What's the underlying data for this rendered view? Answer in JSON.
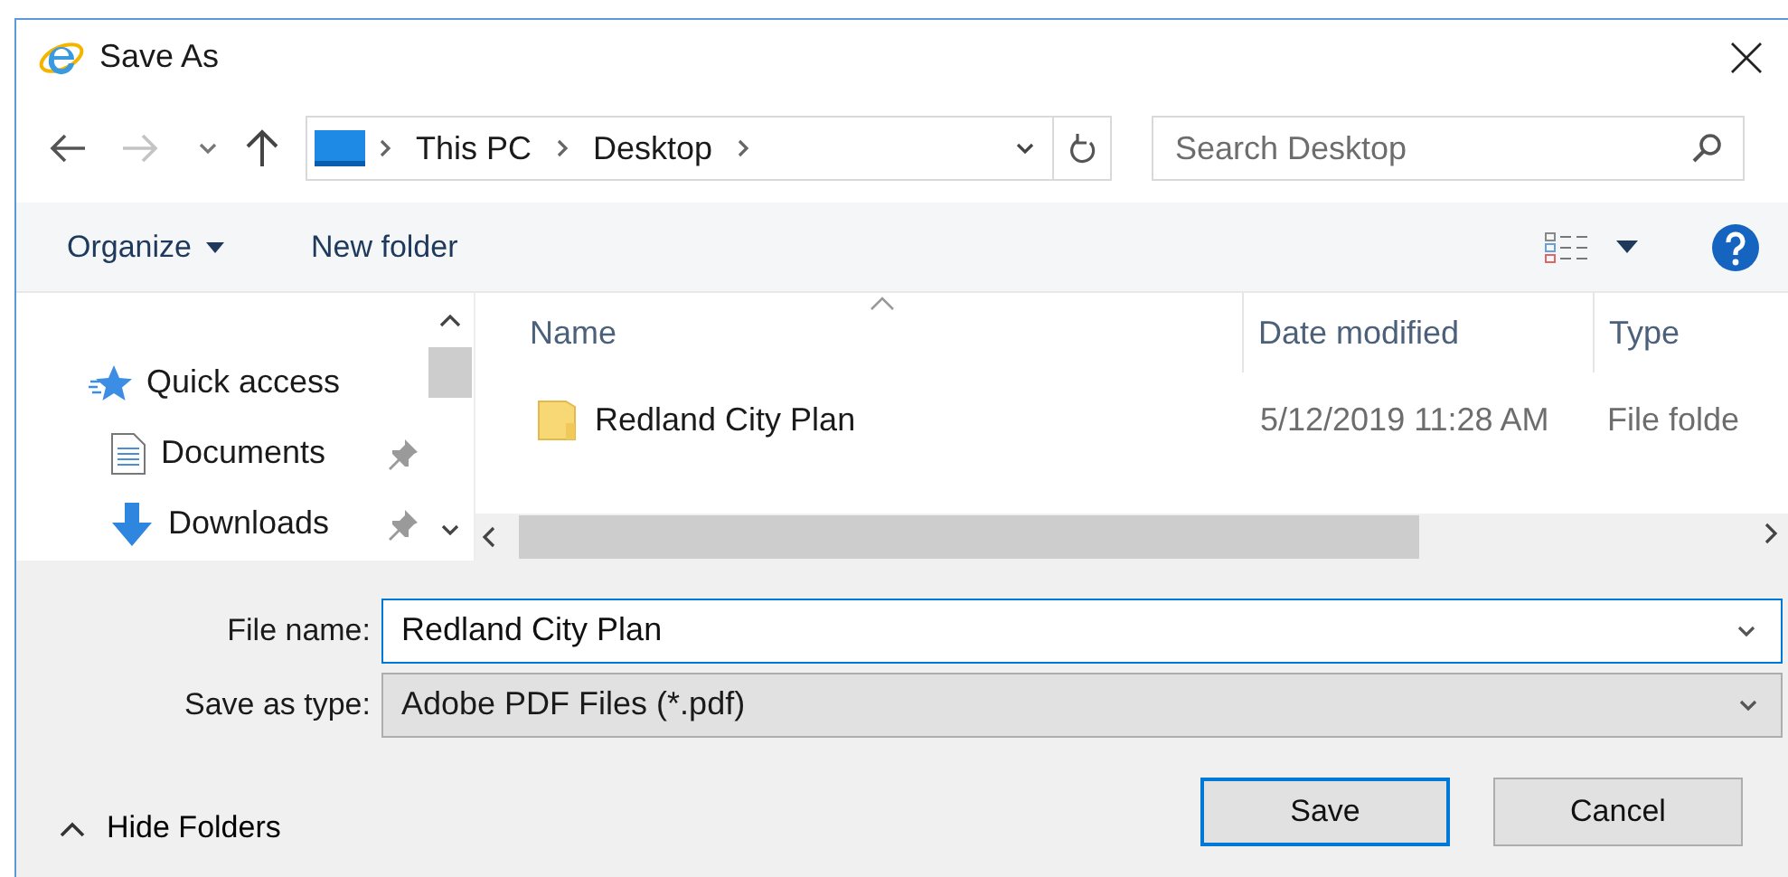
{
  "window": {
    "title": "Save As"
  },
  "address": {
    "path": [
      "This PC",
      "Desktop"
    ]
  },
  "search": {
    "placeholder": "Search Desktop"
  },
  "toolbar": {
    "organize": "Organize",
    "new_folder": "New folder"
  },
  "nav_pane": {
    "items": [
      {
        "kind": "quick",
        "label": "Quick access",
        "pinned": false
      },
      {
        "kind": "documents",
        "label": "Documents",
        "pinned": true
      },
      {
        "kind": "downloads",
        "label": "Downloads",
        "pinned": true
      }
    ]
  },
  "file_list": {
    "columns": [
      "Name",
      "Date modified",
      "Type"
    ],
    "rows": [
      {
        "name": "Redland City Plan",
        "date": "5/12/2019 11:28 AM",
        "type": "File folde"
      }
    ]
  },
  "file_name": {
    "label": "File name:",
    "value": "Redland City Plan"
  },
  "save_as_type": {
    "label": "Save as type:",
    "value": "Adobe PDF Files (*.pdf)"
  },
  "hide_folders": "Hide Folders",
  "buttons": [
    {
      "label": "Save",
      "default": true
    },
    {
      "label": "Cancel",
      "default": false
    }
  ]
}
